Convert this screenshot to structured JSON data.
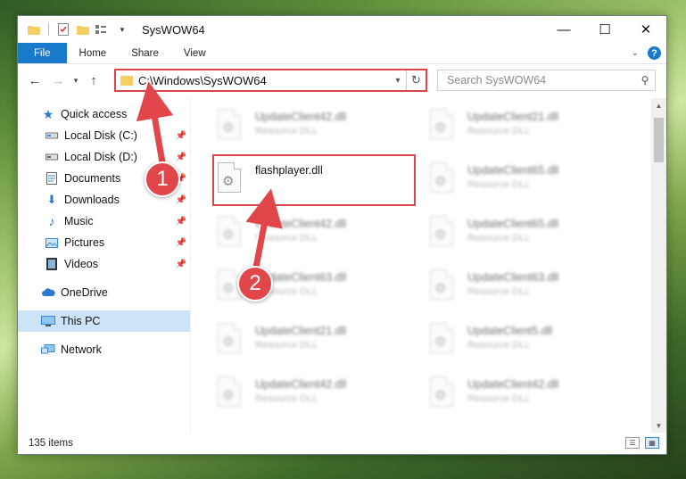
{
  "window": {
    "title": "SysWOW64",
    "controls": {
      "minimize": "—",
      "maximize": "☐",
      "close": "✕"
    }
  },
  "ribbon": {
    "tabs": [
      "File",
      "Home",
      "Share",
      "View"
    ]
  },
  "address": {
    "path": "C:\\Windows\\SysWOW64",
    "search_placeholder": "Search SysWOW64"
  },
  "sidebar": {
    "quick_access": "Quick access",
    "pinned": [
      {
        "label": "Local Disk (C:)",
        "icon": "drive-icon"
      },
      {
        "label": "Local Disk (D:)",
        "icon": "drive-icon"
      },
      {
        "label": "Documents",
        "icon": "documents-icon"
      },
      {
        "label": "Downloads",
        "icon": "downloads-icon"
      },
      {
        "label": "Music",
        "icon": "music-icon"
      },
      {
        "label": "Pictures",
        "icon": "pictures-icon"
      },
      {
        "label": "Videos",
        "icon": "videos-icon"
      }
    ],
    "onedrive": "OneDrive",
    "this_pc": "This PC",
    "network": "Network"
  },
  "files": {
    "highlighted": {
      "name": "flashplayer.dll",
      "type": ""
    },
    "blurred": [
      {
        "name": "UpdateClient42.dll",
        "type": "Resource DLL"
      },
      {
        "name": "UpdateClient21.dll",
        "type": "Resource DLL"
      },
      {
        "name": "UpdateClient65.dll",
        "type": "Resource DLL"
      },
      {
        "name": "UpdateClient42.dll",
        "type": "Resource DLL"
      },
      {
        "name": "UpdateClient65.dll",
        "type": "Resource DLL"
      },
      {
        "name": "UpdateClient63.dll",
        "type": "Resource DLL"
      },
      {
        "name": "UpdateClient63.dll",
        "type": "Resource DLL"
      },
      {
        "name": "UpdateClient21.dll",
        "type": "Resource DLL"
      },
      {
        "name": "UpdateClient5.dll",
        "type": "Resource DLL"
      },
      {
        "name": "UpdateClient42.dll",
        "type": "Resource DLL"
      },
      {
        "name": "UpdateClient42.dll",
        "type": "Resource DLL"
      }
    ]
  },
  "status": {
    "item_count": "135 items"
  },
  "annotations": {
    "step1": "1",
    "step2": "2",
    "accent_color": "#e0464a"
  }
}
